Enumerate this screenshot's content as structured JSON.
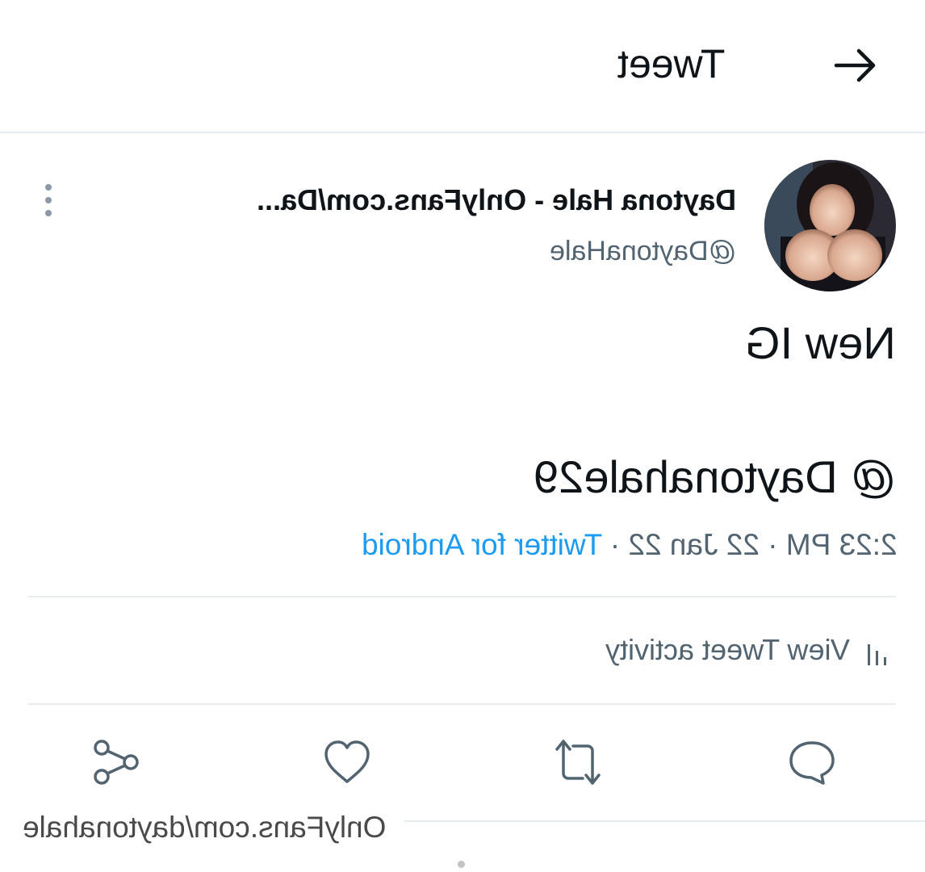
{
  "header": {
    "title": "Tweet",
    "back_icon": "arrow-icon"
  },
  "author": {
    "display_name": "Daytona Hale - OnlyFans.com/Da...",
    "handle": "@DaytonaHale",
    "more_icon": "more-vertical-icon"
  },
  "tweet": {
    "line1": "New IG",
    "line2": "@ Daytonahale29"
  },
  "meta": {
    "time": "2:23 PM",
    "sep1": " · ",
    "date": "22 Jan 22",
    "sep2": " · ",
    "source": "Twitter for Android"
  },
  "activity": {
    "label": "View Tweet activity",
    "icon": "bar-chart-icon"
  },
  "actions": [
    {
      "icon": "reply-icon"
    },
    {
      "icon": "retweet-icon"
    },
    {
      "icon": "heart-icon"
    },
    {
      "icon": "share-icon"
    }
  ],
  "watermark": "OnlyFans.com/daytonahale",
  "colors": {
    "accent": "#1d9bf0",
    "secondary_text": "#536471",
    "divider": "#e6ecf0"
  }
}
